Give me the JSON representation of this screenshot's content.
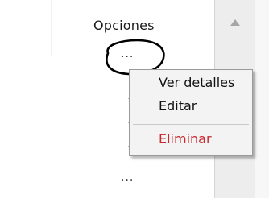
{
  "table": {
    "header": "Opciones",
    "rows": [
      {
        "actions_label": "..."
      },
      {
        "actions_label": "..."
      }
    ]
  },
  "context_menu": {
    "items": [
      {
        "label": "Ver detalles",
        "color": "#111111"
      },
      {
        "label": "Editar",
        "color": "#111111"
      },
      {
        "label": "Eliminar",
        "color": "#c8282e"
      }
    ]
  },
  "scrollbar": {
    "up_icon": "triangle-up-icon"
  },
  "annotation": {
    "shape": "ellipse",
    "color": "#000000"
  }
}
